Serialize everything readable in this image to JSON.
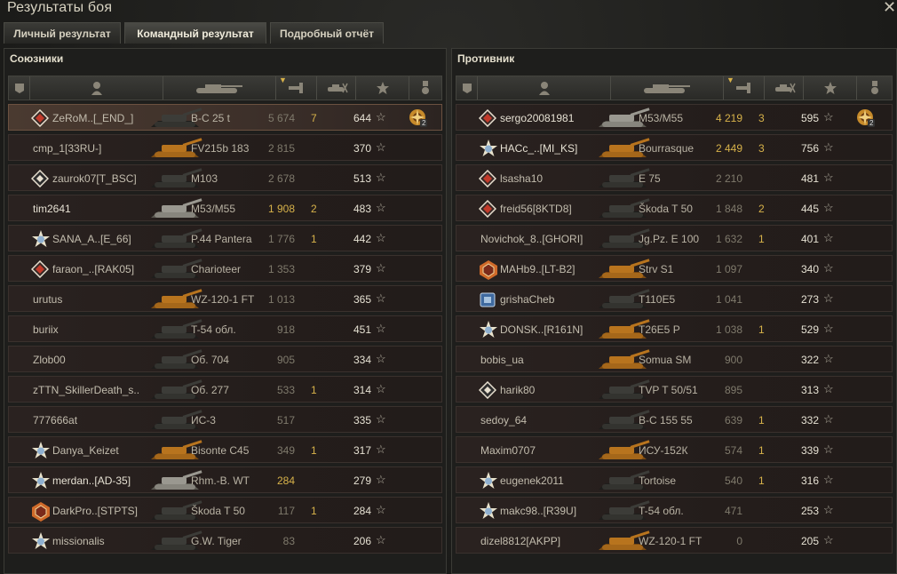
{
  "window": {
    "title": "Результаты боя",
    "close_glyph": "✕"
  },
  "tabs": [
    {
      "label": "Личный результат",
      "active": false
    },
    {
      "label": "Командный результат",
      "active": true
    },
    {
      "label": "Подробный отчёт",
      "active": false
    }
  ],
  "star_glyph": "☆",
  "medal_count": "2",
  "colors": {
    "gold": "#d7b24a",
    "muted": "#7f7a6c",
    "text": "#c3bdae"
  },
  "allies": {
    "title": "Союзники",
    "rows": [
      {
        "badge": "rank-red-diamond",
        "name": "ZeRoM..[_END_]",
        "vehicle": "B-C 25 t",
        "tank_color": "dark",
        "damage": "5 674",
        "damage_gold": false,
        "kills": "7",
        "xp": "644",
        "medal": true,
        "self": true
      },
      {
        "badge": "",
        "name": "cmp_1[33RU-]",
        "vehicle": "FV215b 183",
        "tank_color": "orange",
        "damage": "2 815",
        "damage_gold": false,
        "kills": "",
        "xp": "370",
        "medal": false
      },
      {
        "badge": "rank-white-diamond",
        "name": "zaurok07[T_BSC]",
        "vehicle": "M103",
        "tank_color": "dark",
        "damage": "2 678",
        "damage_gold": false,
        "kills": "",
        "xp": "513",
        "medal": false
      },
      {
        "badge": "",
        "name": "tim2641",
        "vehicle": "M53/M55",
        "tank_color": "grey",
        "damage": "1 908",
        "damage_gold": true,
        "kills": "2",
        "xp": "483",
        "medal": false,
        "white": true
      },
      {
        "badge": "rank-star",
        "name": "SANA_A..[E_66]",
        "vehicle": "P.44 Pantera",
        "tank_color": "dark",
        "damage": "1 776",
        "damage_gold": false,
        "kills": "1",
        "xp": "442",
        "medal": false
      },
      {
        "badge": "rank-red-diamond",
        "name": "faraon_..[RAK05]",
        "vehicle": "Charioteer",
        "tank_color": "dark",
        "damage": "1 353",
        "damage_gold": false,
        "kills": "",
        "xp": "379",
        "medal": false
      },
      {
        "badge": "",
        "name": "urutus",
        "vehicle": "WZ-120-1 FT",
        "tank_color": "orange",
        "damage": "1 013",
        "damage_gold": false,
        "kills": "",
        "xp": "365",
        "medal": false
      },
      {
        "badge": "",
        "name": "buriix",
        "vehicle": "T-54 обл.",
        "tank_color": "dark",
        "damage": "918",
        "damage_gold": false,
        "kills": "",
        "xp": "451",
        "medal": false
      },
      {
        "badge": "",
        "name": "Zlob00",
        "vehicle": "Об. 704",
        "tank_color": "dark",
        "damage": "905",
        "damage_gold": false,
        "kills": "",
        "xp": "334",
        "medal": false
      },
      {
        "badge": "",
        "name": "zTTN_SkillerDeath_s..",
        "vehicle": "Об. 277",
        "tank_color": "dark",
        "damage": "533",
        "damage_gold": false,
        "kills": "1",
        "xp": "314",
        "medal": false
      },
      {
        "badge": "",
        "name": "777666at",
        "vehicle": "ИС-3",
        "tank_color": "dark",
        "damage": "517",
        "damage_gold": false,
        "kills": "",
        "xp": "335",
        "medal": false
      },
      {
        "badge": "rank-star",
        "name": "Danya_Keizet",
        "vehicle": "Bisonte C45",
        "tank_color": "orange",
        "damage": "349",
        "damage_gold": false,
        "kills": "1",
        "xp": "317",
        "medal": false
      },
      {
        "badge": "rank-star",
        "name": "merdan..[AD-35]",
        "vehicle": "Rhm.-B. WT",
        "tank_color": "grey",
        "damage": "284",
        "damage_gold": true,
        "kills": "",
        "xp": "279",
        "medal": false,
        "white": true
      },
      {
        "badge": "rank-ornate-red",
        "name": "DarkPro..[STPTS]",
        "vehicle": "Škoda T 50",
        "tank_color": "dark",
        "damage": "117",
        "damage_gold": false,
        "kills": "1",
        "xp": "284",
        "medal": false
      },
      {
        "badge": "rank-star",
        "name": "missionalis",
        "vehicle": "G.W. Tiger",
        "tank_color": "dark",
        "damage": "83",
        "damage_gold": false,
        "kills": "",
        "xp": "206",
        "medal": false
      }
    ]
  },
  "enemies": {
    "title": "Противник",
    "rows": [
      {
        "badge": "rank-red-diamond",
        "name": "sergo20081981",
        "vehicle": "M53/M55",
        "tank_color": "grey",
        "damage": "4 219",
        "damage_gold": true,
        "kills": "3",
        "xp": "595",
        "medal": true,
        "white": true
      },
      {
        "badge": "rank-star",
        "name": "HACc_..[MI_KS]",
        "vehicle": "Bourrasque",
        "tank_color": "orange",
        "damage": "2 449",
        "damage_gold": true,
        "kills": "3",
        "xp": "756",
        "medal": false,
        "white": true
      },
      {
        "badge": "rank-red-diamond",
        "name": "lsasha10",
        "vehicle": "E 75",
        "tank_color": "dark",
        "damage": "2 210",
        "damage_gold": false,
        "kills": "",
        "xp": "481",
        "medal": false
      },
      {
        "badge": "rank-red-diamond",
        "name": "freid56[8KTD8]",
        "vehicle": "Škoda T 50",
        "tank_color": "dark",
        "damage": "1 848",
        "damage_gold": false,
        "kills": "2",
        "xp": "445",
        "medal": false
      },
      {
        "badge": "",
        "name": "Novichok_8..[GHORI]",
        "vehicle": "Jg.Pz. E 100",
        "tank_color": "dark",
        "damage": "1 632",
        "damage_gold": false,
        "kills": "1",
        "xp": "401",
        "medal": false
      },
      {
        "badge": "rank-ornate-red",
        "name": "MAHb9..[LT-B2]",
        "vehicle": "Strv S1",
        "tank_color": "orange",
        "damage": "1 097",
        "damage_gold": false,
        "kills": "",
        "xp": "340",
        "medal": false
      },
      {
        "badge": "rank-blue",
        "name": "grishaCheb",
        "vehicle": "T110E5",
        "tank_color": "dark",
        "damage": "1 041",
        "damage_gold": false,
        "kills": "",
        "xp": "273",
        "medal": false
      },
      {
        "badge": "rank-star",
        "name": "DONSK..[R161N]",
        "vehicle": "T26E5 P",
        "tank_color": "orange",
        "damage": "1 038",
        "damage_gold": false,
        "kills": "1",
        "xp": "529",
        "medal": false
      },
      {
        "badge": "",
        "name": "bobis_ua",
        "vehicle": "Somua SM",
        "tank_color": "orange",
        "damage": "900",
        "damage_gold": false,
        "kills": "",
        "xp": "322",
        "medal": false
      },
      {
        "badge": "rank-white-diamond",
        "name": "harik80",
        "vehicle": "TVP T 50/51",
        "tank_color": "dark",
        "damage": "895",
        "damage_gold": false,
        "kills": "",
        "xp": "313",
        "medal": false
      },
      {
        "badge": "",
        "name": "sedoy_64",
        "vehicle": "B-C 155 55",
        "tank_color": "dark",
        "damage": "639",
        "damage_gold": false,
        "kills": "1",
        "xp": "332",
        "medal": false
      },
      {
        "badge": "",
        "name": "Maxim0707",
        "vehicle": "ИСУ-152К",
        "tank_color": "orange",
        "damage": "574",
        "damage_gold": false,
        "kills": "1",
        "xp": "339",
        "medal": false
      },
      {
        "badge": "rank-star",
        "name": "eugenek2011",
        "vehicle": "Tortoise",
        "tank_color": "dark",
        "damage": "540",
        "damage_gold": false,
        "kills": "1",
        "xp": "316",
        "medal": false
      },
      {
        "badge": "rank-star",
        "name": "makc98..[R39U]",
        "vehicle": "T-54 обл.",
        "tank_color": "dark",
        "damage": "471",
        "damage_gold": false,
        "kills": "",
        "xp": "253",
        "medal": false
      },
      {
        "badge": "",
        "name": "dizel8812[AKPP]",
        "vehicle": "WZ-120-1 FT",
        "tank_color": "orange",
        "damage": "0",
        "damage_gold": false,
        "kills": "",
        "xp": "205",
        "medal": false
      }
    ]
  }
}
